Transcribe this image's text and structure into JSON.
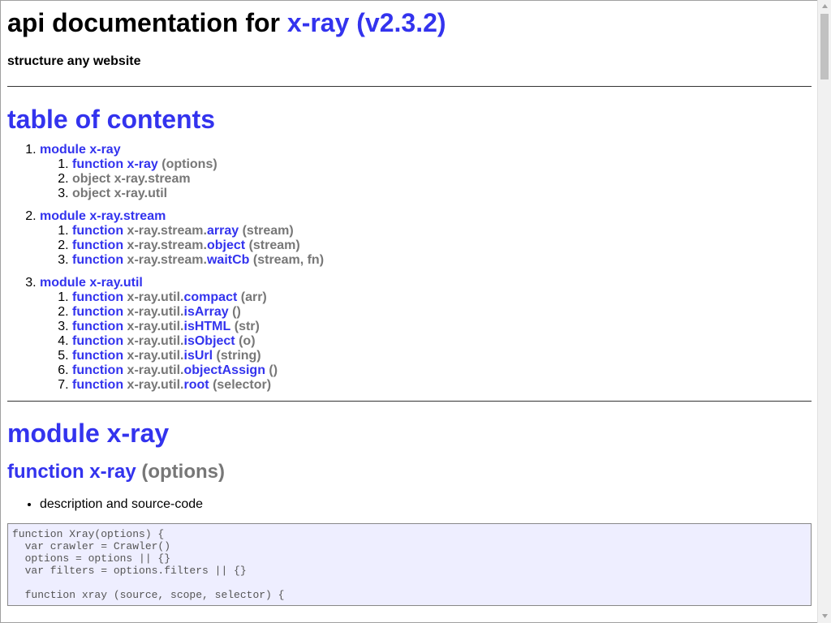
{
  "header": {
    "title_prefix": "api documentation for",
    "title_name": "x-ray",
    "title_version": "(v2.3.2)",
    "subtitle": "structure any website"
  },
  "toc": {
    "title": "table of contents",
    "modules": [
      {
        "label": "module x-ray",
        "items": [
          {
            "kind": "function",
            "prefix": "",
            "name": "x-ray",
            "args": "(options)"
          },
          {
            "kind": "object",
            "prefix": "x-ray.stream",
            "name": "",
            "args": ""
          },
          {
            "kind": "object",
            "prefix": "x-ray.util",
            "name": "",
            "args": ""
          }
        ]
      },
      {
        "label": "module x-ray.stream",
        "items": [
          {
            "kind": "function",
            "prefix": "x-ray.stream.",
            "name": "array",
            "args": "(stream)"
          },
          {
            "kind": "function",
            "prefix": "x-ray.stream.",
            "name": "object",
            "args": "(stream)"
          },
          {
            "kind": "function",
            "prefix": "x-ray.stream.",
            "name": "waitCb",
            "args": "(stream, fn)"
          }
        ]
      },
      {
        "label": "module x-ray.util",
        "items": [
          {
            "kind": "function",
            "prefix": "x-ray.util.",
            "name": "compact",
            "args": "(arr)"
          },
          {
            "kind": "function",
            "prefix": "x-ray.util.",
            "name": "isArray",
            "args": "()"
          },
          {
            "kind": "function",
            "prefix": "x-ray.util.",
            "name": "isHTML",
            "args": "(str)"
          },
          {
            "kind": "function",
            "prefix": "x-ray.util.",
            "name": "isObject",
            "args": "(o)"
          },
          {
            "kind": "function",
            "prefix": "x-ray.util.",
            "name": "isUrl",
            "args": "(string)"
          },
          {
            "kind": "function",
            "prefix": "x-ray.util.",
            "name": "objectAssign",
            "args": "()"
          },
          {
            "kind": "function",
            "prefix": "x-ray.util.",
            "name": "root",
            "args": "(selector)"
          }
        ]
      }
    ]
  },
  "section": {
    "module_title": "module x-ray",
    "function_label": "function x-ray",
    "function_args": "(options)",
    "bullet": "description and source-code",
    "code": "function Xray(options) {\n  var crawler = Crawler()\n  options = options || {}\n  var filters = options.filters || {}\n\n  function xray (source, scope, selector) {"
  }
}
